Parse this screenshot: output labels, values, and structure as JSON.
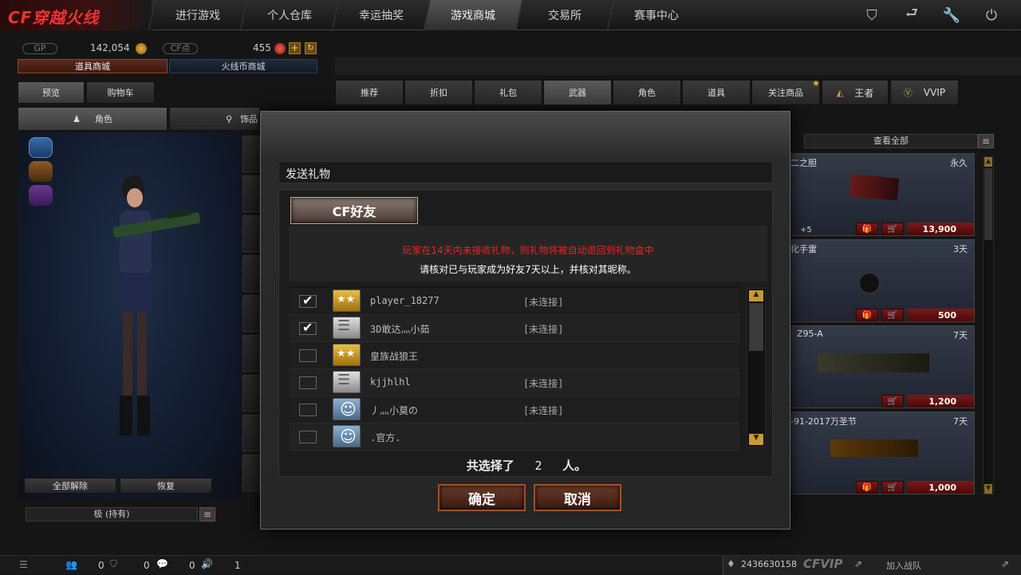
{
  "topnav": {
    "logo_text": "CF穿越火线",
    "items": [
      "进行游戏",
      "个人仓库",
      "幸运抽奖",
      "游戏商城",
      "交易所",
      "赛事中心"
    ],
    "active_index": 3
  },
  "currency": {
    "gp_label": "GP",
    "gp_value": "142,054",
    "cf_label": "CF点",
    "cf_value": "455"
  },
  "shop_tabs": [
    "道具商城",
    "火线币商城"
  ],
  "left_tabs": [
    "预览",
    "购物车"
  ],
  "left_subtabs": [
    "角色",
    "饰品"
  ],
  "left_buttons": {
    "unequip_all": "全部解除",
    "restore": "恢复"
  },
  "left_filter": "极 (持有)",
  "categories": [
    "推荐",
    "折扣",
    "礼包",
    "武器",
    "角色",
    "道具",
    "关注商品",
    "王者",
    "VVIP"
  ],
  "active_category": 3,
  "view_all": "查看全部",
  "items": [
    {
      "name": "二之胆",
      "duration": "永久",
      "bonus": "+5",
      "price": "13,900"
    },
    {
      "name": "化手雷",
      "duration": "3天",
      "price": "500"
    },
    {
      "name": "Z95-A",
      "duration": "7天",
      "price": "1,200"
    },
    {
      "name": "-91-2017万圣节",
      "duration": "7天",
      "price": "1,000"
    }
  ],
  "dialog": {
    "title": "发送礼物",
    "tab_friends": "CF好友",
    "notice_red": "玩家在14天内未接收礼物，则礼物将被自动退回到礼物盒中",
    "notice_white": "请核对已与玩家成为好友7天以上，并核对其昵称。",
    "friends": [
      {
        "name": "player_18277",
        "status": "[未连接]",
        "checked": true,
        "rank": "gold-stars"
      },
      {
        "name": "3D敢达灬小茹",
        "status": "[未连接]",
        "checked": true,
        "rank": "silver-bars"
      },
      {
        "name": "皇族战狼王",
        "status": "",
        "checked": false,
        "rank": "gold-stars"
      },
      {
        "name": "kjjhlhl",
        "status": "[未连接]",
        "checked": false,
        "rank": "silver-bars"
      },
      {
        "name": "丿灬小莫の",
        "status": "[未连接]",
        "checked": false,
        "rank": "smiley"
      },
      {
        "name": ".官方.",
        "status": "",
        "checked": false,
        "rank": "smiley"
      }
    ],
    "selected_prefix": "共选择了",
    "selected_count": "2",
    "selected_suffix": "人。",
    "confirm": "确定",
    "cancel": "取消"
  },
  "bottom": {
    "count1": "0",
    "count2": "0",
    "count3": "0",
    "count4": "1",
    "user_id": "2436630158",
    "vip": "CFVIP",
    "join": "加入战队"
  }
}
